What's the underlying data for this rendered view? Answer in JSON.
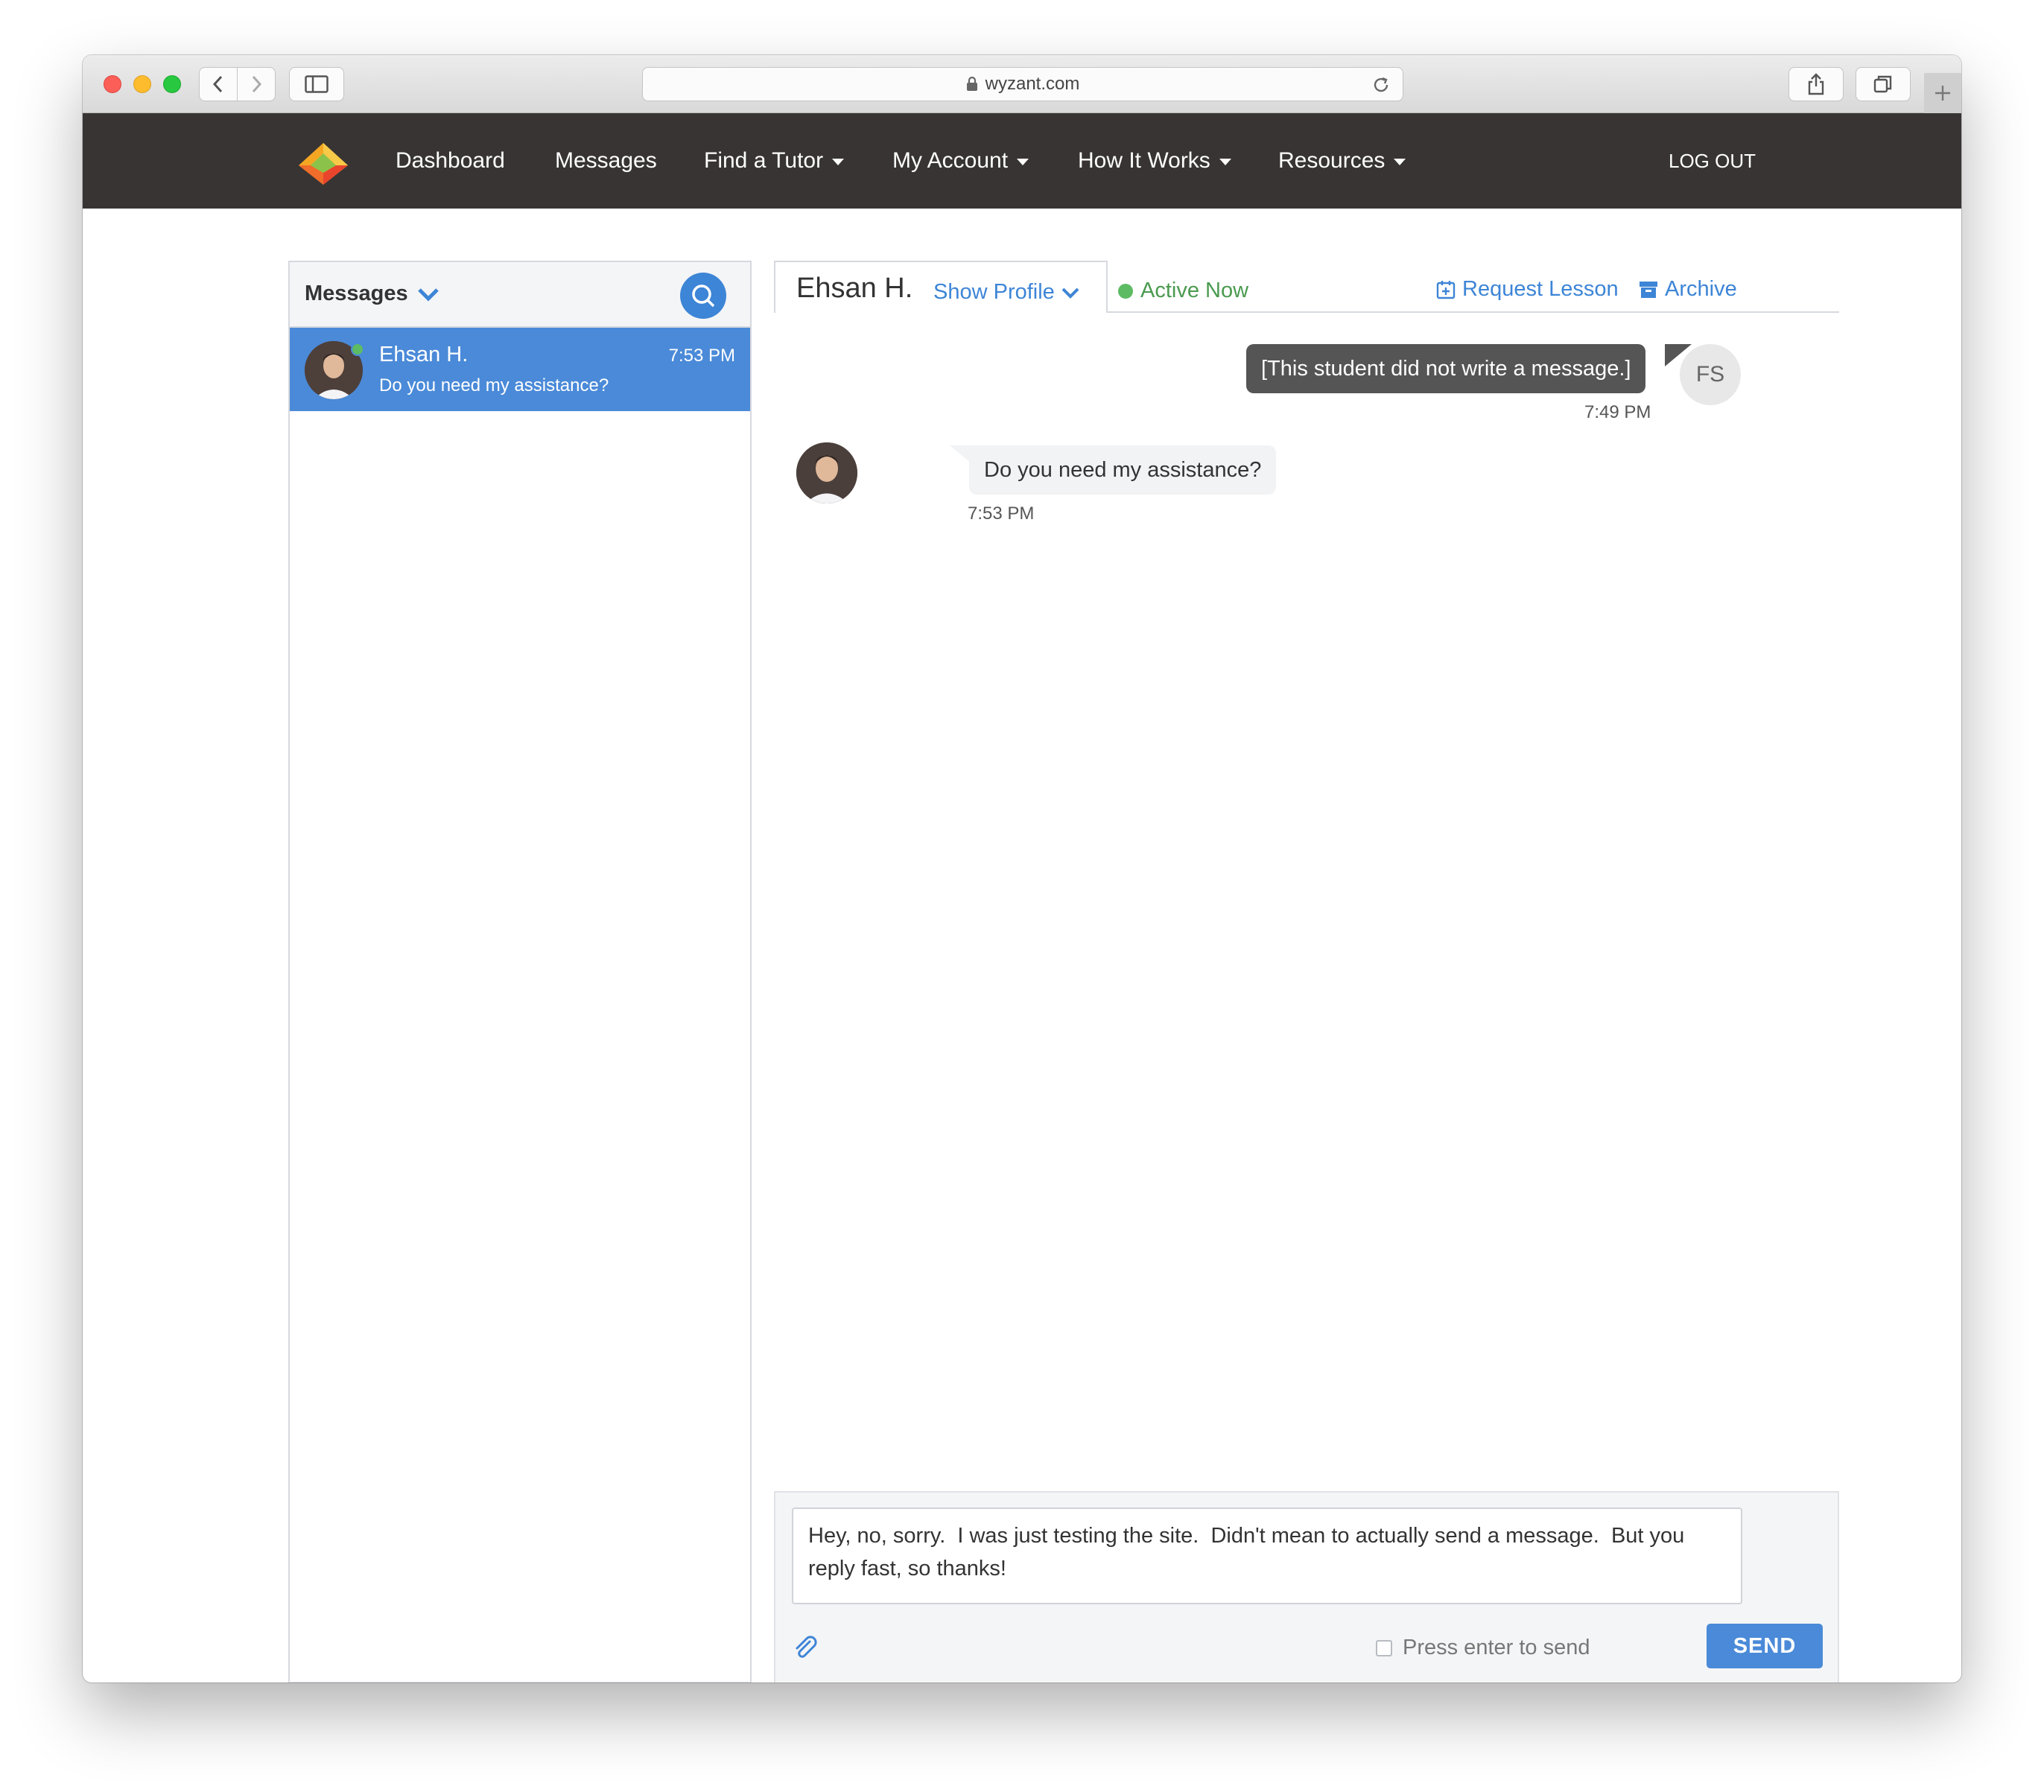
{
  "browser": {
    "url": "wyzant.com"
  },
  "nav": {
    "items": [
      {
        "label": "Dashboard"
      },
      {
        "label": "Messages"
      },
      {
        "label": "Find a Tutor"
      },
      {
        "label": "My Account"
      },
      {
        "label": "How It Works"
      },
      {
        "label": "Resources"
      }
    ],
    "logout": "LOG OUT"
  },
  "sidebar": {
    "title": "Messages",
    "conversations": [
      {
        "name": "Ehsan H.",
        "time": "7:53 PM",
        "preview": "Do you need my assistance?",
        "online": true
      }
    ]
  },
  "chat": {
    "name": "Ehsan H.",
    "show_profile": "Show Profile",
    "status": "Active Now",
    "request_lesson": "Request Lesson",
    "archive": "Archive",
    "messages": [
      {
        "from": "me",
        "avatar_initials": "FS",
        "text": "[This student did not write a message.]",
        "time": "7:49 PM"
      },
      {
        "from": "tutor",
        "text": "Do you need my assistance?",
        "time": "7:53 PM"
      }
    ]
  },
  "composer": {
    "value": "Hey, no, sorry.  I was just testing the site.  Didn't mean to actually send a message.  But you reply fast, so thanks!",
    "press_enter_label": "Press enter to send",
    "send_label": "SEND"
  },
  "colors": {
    "header_bg": "#383433",
    "accent": "#4a8ad8",
    "online": "#5dbb63"
  }
}
